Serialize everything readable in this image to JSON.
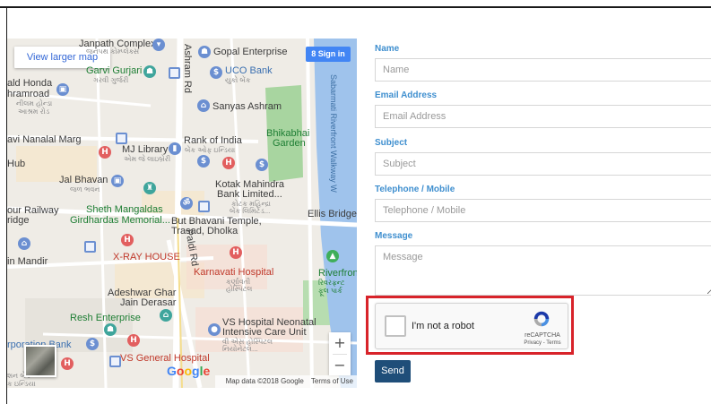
{
  "map": {
    "larger_map_link": "View larger map",
    "sign_in": "Sign in",
    "zoom_in": "+",
    "zoom_out": "−",
    "google_logo": [
      "G",
      "o",
      "o",
      "g",
      "l",
      "e"
    ],
    "attribution": "Map data ©2018 Google",
    "terms": "Terms of Use",
    "labels": {
      "janpath": "Janpath Complex",
      "janpath_gu": "જનપથ કોમ્પ્લેક્સ",
      "ashram_rd": "Ashram Rd",
      "gopal": "Gopal Enterprise",
      "uco": "UCO Bank",
      "uco_gu": "યુકો બેંક",
      "garvi": "Garvi Gurjari",
      "garvi_gu": "ગરવી ગુર્જરી",
      "honda": "ald Honda",
      "hramroad": "hramroad",
      "hramroad_gu": "નીલમ હોન્ડા",
      "ashram_gu": "આશ્રમ રોડ",
      "sabarmati": "Sabarmati Riverfront Walkway W",
      "sanyas": "Sanyas Ashram",
      "bhikabhai": "Bhikabhai",
      "garden": "Garden",
      "nanalal": "avi Nanalal Marg",
      "mj": "MJ Library",
      "mj_gu": "એમ જે લાઇબ્રેરી",
      "rbi": "Rank of India",
      "rbi_gu": "બેંક ઓફ ઇન્ડિયા",
      "hub": "Hub",
      "jal": "Jal Bhavan",
      "jal_gu": "જળ ભવન",
      "kotak1": "Kotak Mahindra",
      "kotak2": "Bank Limited...",
      "kotak_gu1": "કોટક મહિન્દ્રા",
      "kotak_gu2": "બેંક લિમિટેડ...",
      "railway": "our Railway",
      "ridge": "ridge",
      "sheth1": "Sheth Mangaldas",
      "sheth2": "Girdhardas Memorial...",
      "bhavani1": "But Bhavani Temple,",
      "bhavani2": "Trasad, Dholka",
      "ellis": "Ellis Bridge",
      "paldi": "Paldi Rd",
      "mandir": "in Mandir",
      "xray": "X-RAY HOUSE",
      "karnavati": "Karnavati Hospital",
      "karnavati_gu1": "કર્ણાવતી",
      "karnavati_gu2": "હોસ્પિટલ",
      "riverfront": "Riverfront",
      "riverfront_gu1": "રિવરફ્રન્ટ",
      "riverfront_gu2": "ફૂલ પાર્ક",
      "adeshwar1": "Adeshwar Ghar",
      "adeshwar2": "Jain Derasar",
      "resh": "Resh Enterprise",
      "vs1": "VS Hospital Neonatal",
      "vs2": "Intensive Care Unit",
      "vs_gu1": "વી એસ હોસ્પિટલ",
      "vs_gu2": "નિયોનેટલ...",
      "corp": "rporation Bank",
      "vsgen": "VS General Hospital",
      "bottom_gu1": "શન બેંક",
      "bottom_gu2": "ક ઇન્ડિયા"
    }
  },
  "form": {
    "name_label": "Name",
    "name_placeholder": "Name",
    "email_label": "Email Address",
    "email_placeholder": "Email Address",
    "subject_label": "Subject",
    "subject_placeholder": "Subject",
    "phone_label": "Telephone / Mobile",
    "phone_placeholder": "Telephone / Mobile",
    "message_label": "Message",
    "message_placeholder": "Message",
    "send_label": "Send"
  },
  "recaptcha": {
    "checkbox_text": "I'm not a robot",
    "brand": "reCAPTCHA",
    "privacy": "Privacy",
    "terms": "Terms"
  },
  "colors": {
    "label_blue": "#3f8fcf",
    "send_button": "#1f4e79",
    "highlight_red": "#d8232a"
  }
}
